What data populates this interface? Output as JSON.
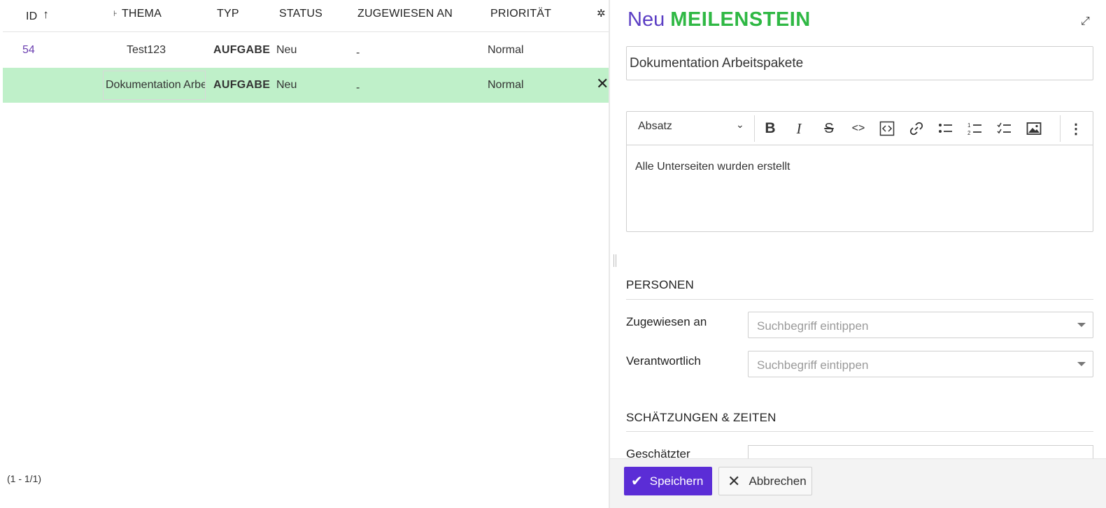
{
  "table": {
    "columns": {
      "id": "ID",
      "subject": "THEMA",
      "type": "TYP",
      "status": "STATUS",
      "assignee": "ZUGEWIESEN AN",
      "priority": "PRIORITÄT"
    },
    "rows": [
      {
        "id": "54",
        "subject": "Test123",
        "type": "AUFGABE",
        "status": "Neu",
        "assignee": "-",
        "priority": "Normal"
      },
      {
        "id": "",
        "subject": "Dokumentation Arbeitspakete",
        "type": "AUFGABE",
        "status": "Neu",
        "assignee": "-",
        "priority": "Normal"
      }
    ],
    "pagination": "(1 - 1/1)",
    "icons": {
      "sort": "arrow-up-icon",
      "hierarchy": "hierarchy-icon",
      "settings": "gear-icon",
      "close": "close-icon"
    }
  },
  "panel": {
    "title_status": "Neu",
    "title_type": "MEILENSTEIN",
    "subject_value": "Dokumentation Arbeitspakete",
    "editor": {
      "heading_select": "Absatz",
      "content": "Alle Unterseiten wurden erstellt"
    },
    "sections": {
      "people": "PERSONEN",
      "estimates": "SCHÄTZUNGEN & ZEITEN"
    },
    "fields": {
      "assignee_label": "Zugewiesen an",
      "assignee_placeholder": "Suchbegriff eintippen",
      "responsible_label": "Verantwortlich",
      "responsible_placeholder": "Suchbegriff eintippen",
      "estimated_label": "Geschätzter"
    },
    "buttons": {
      "save": "Speichern",
      "cancel": "Abbrechen"
    }
  },
  "colors": {
    "accent_purple": "#5b2dd6",
    "type_green": "#2fb844",
    "row_highlight": "#bff0c9",
    "type_link_blue": "#1a67a3"
  }
}
